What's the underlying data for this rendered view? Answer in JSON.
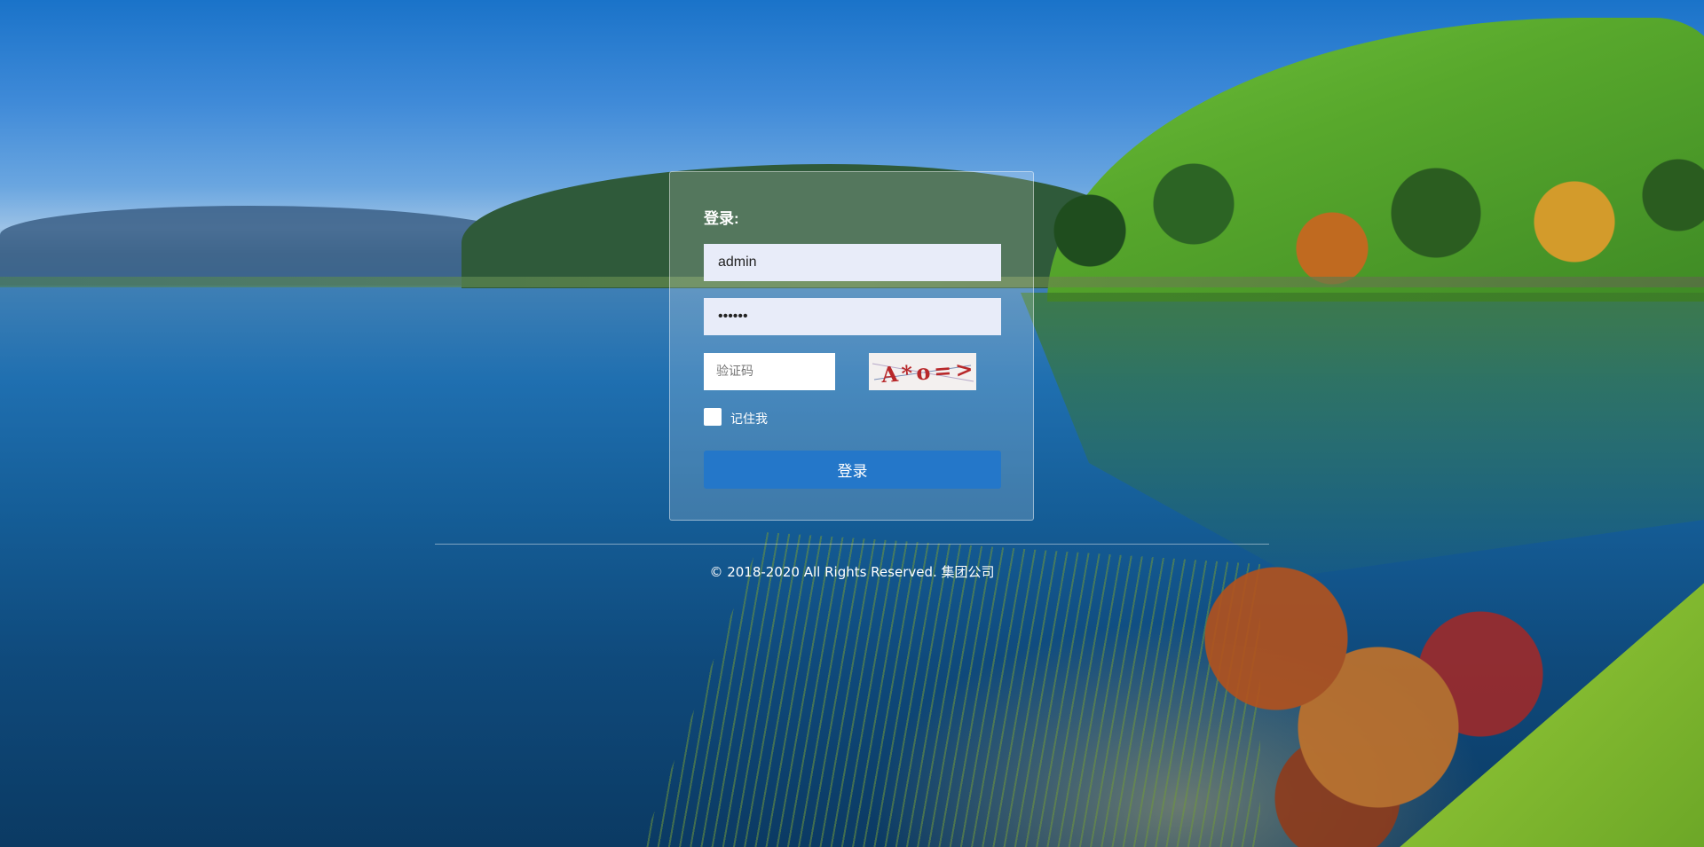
{
  "login": {
    "title": "登录:",
    "username_value": "admin",
    "password_value": "••••••",
    "captcha_placeholder": "验证码",
    "captcha_text": "A*o=>",
    "remember_label": "记住我",
    "remember_checked": false,
    "submit_label": "登录"
  },
  "footer": {
    "copyright": "© 2018-2020 All Rights Reserved. 集团公司"
  },
  "colors": {
    "button": "#2477c9",
    "input_bg": "#e8ecf9"
  }
}
